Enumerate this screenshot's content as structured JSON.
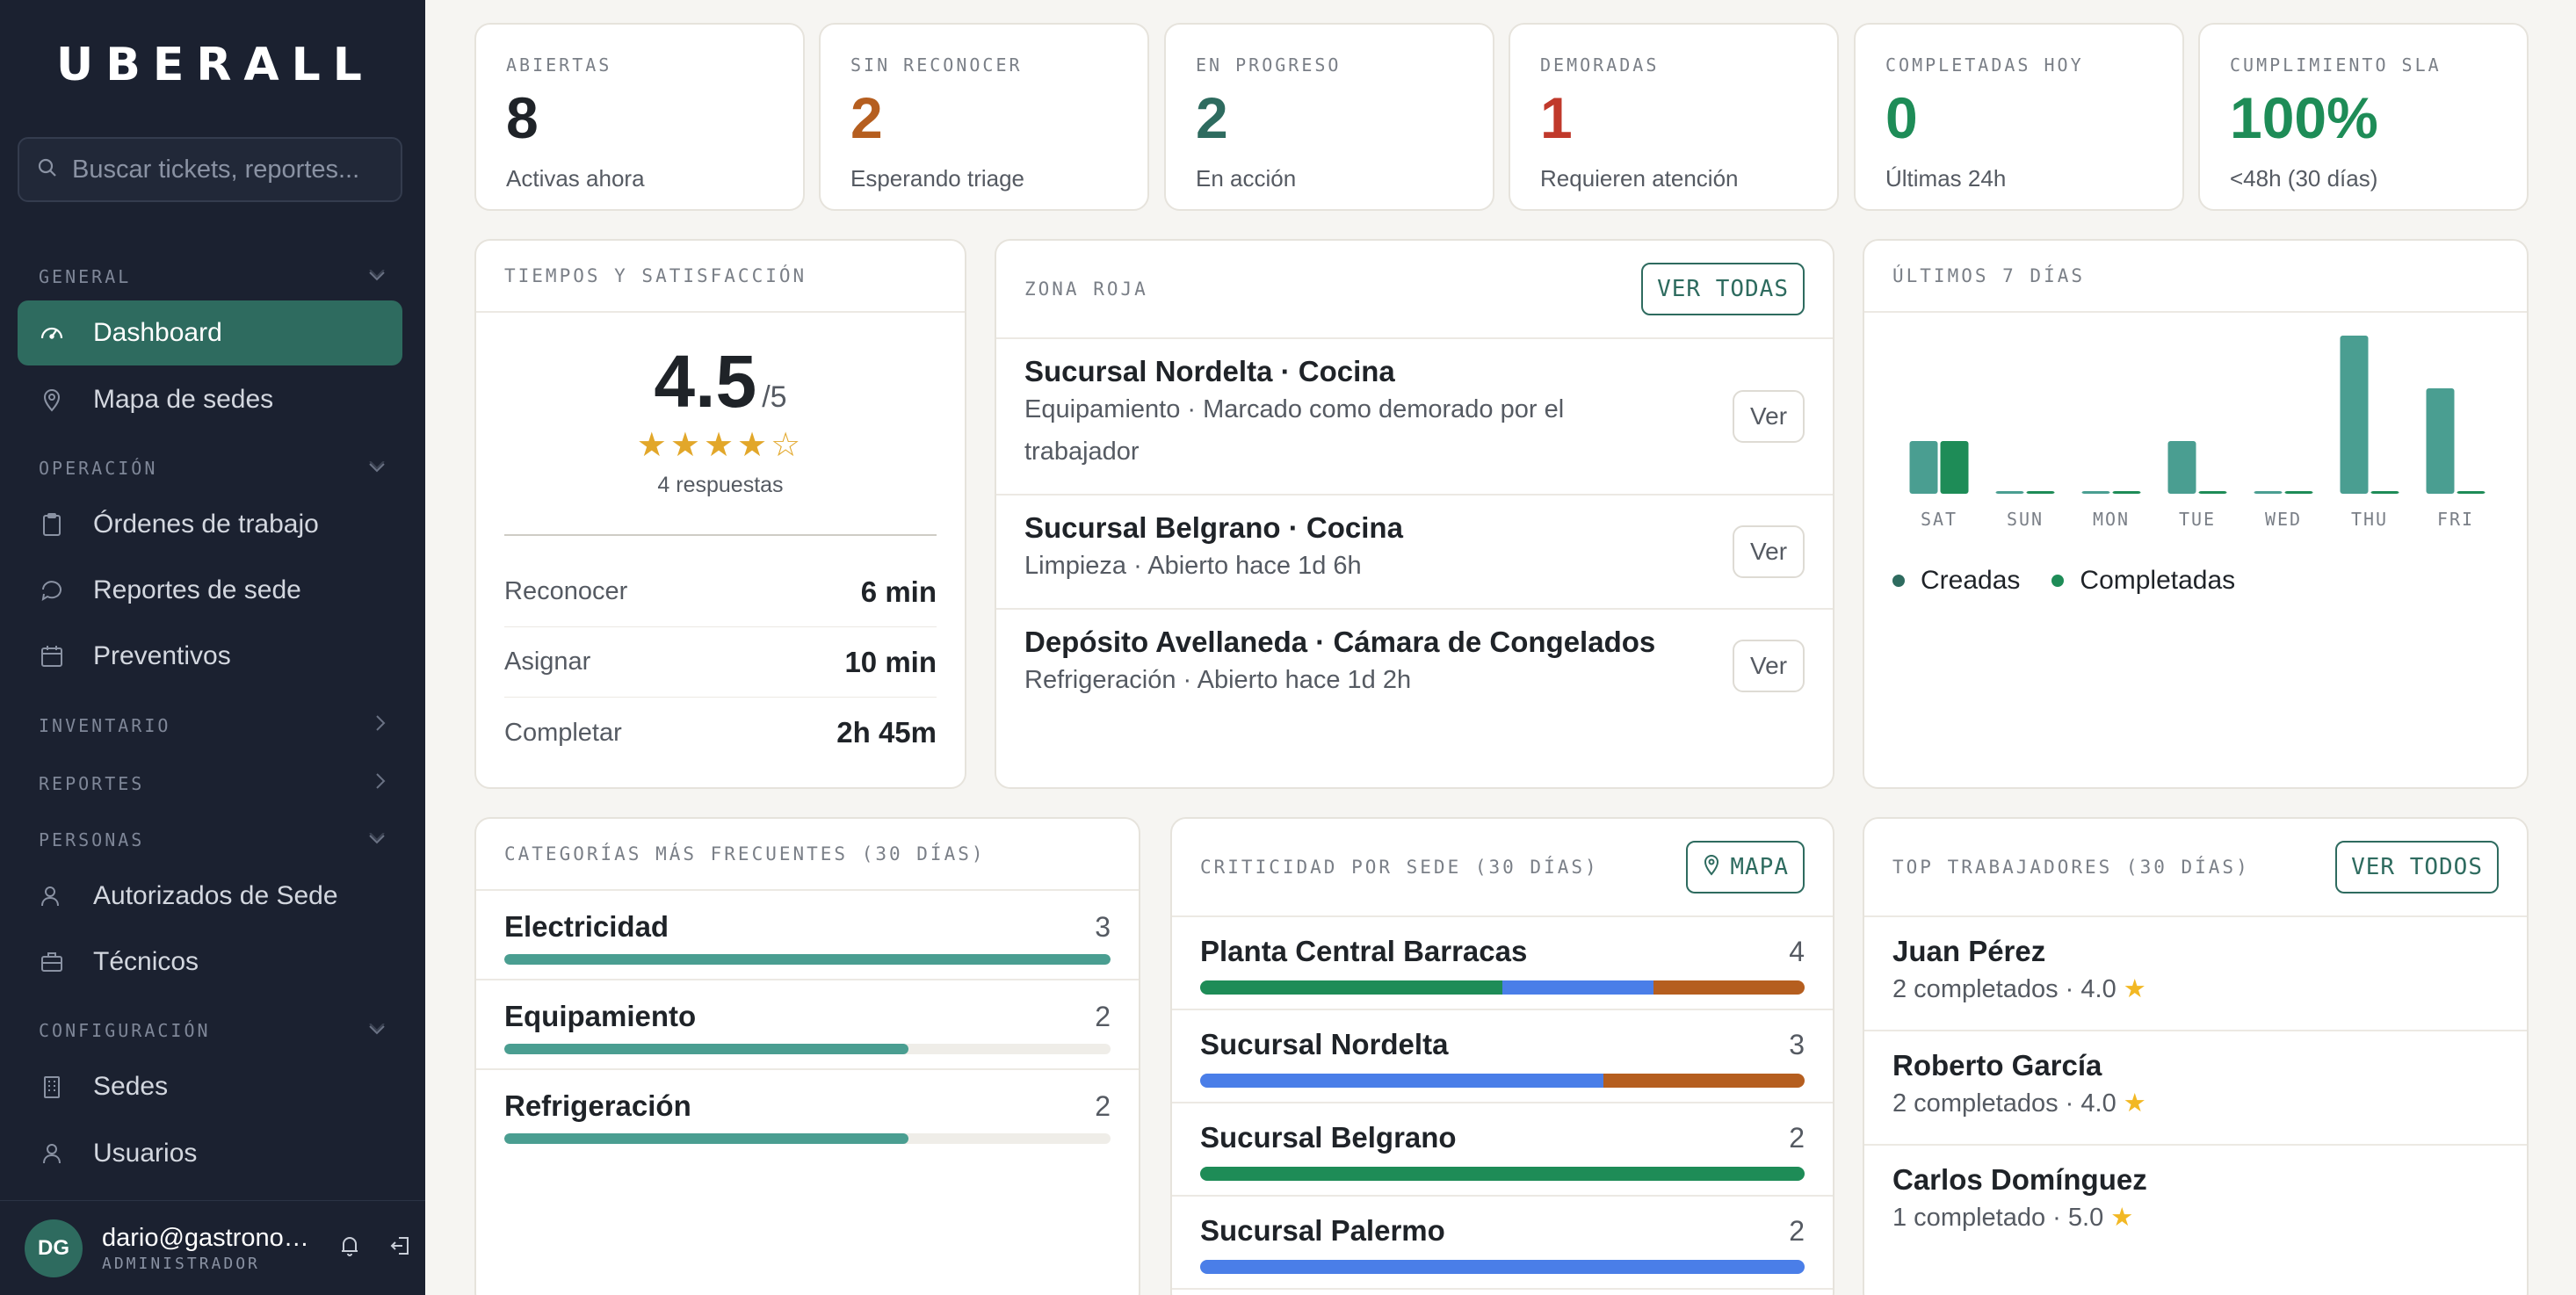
{
  "sidebar": {
    "logo": "UBERALL",
    "search_placeholder": "Buscar tickets, reportes...",
    "sections": {
      "general": "GENERAL",
      "operacion": "OPERACIÓN",
      "inventario": "INVENTARIO",
      "reportes": "REPORTES",
      "personas": "PERSONAS",
      "configuracion": "CONFIGURACIÓN"
    },
    "items": {
      "dashboard": "Dashboard",
      "mapa": "Mapa de sedes",
      "ordenes": "Órdenes de trabajo",
      "reportes_sede": "Reportes de sede",
      "preventivos": "Preventivos",
      "autorizados": "Autorizados de Sede",
      "tecnicos": "Técnicos",
      "sedes": "Sedes",
      "usuarios": "Usuarios"
    },
    "user": {
      "initials": "DG",
      "email": "dario@gastronomia.com",
      "role": "ADMINISTRADOR"
    }
  },
  "kpis": [
    {
      "label": "ABIERTAS",
      "value": "8",
      "sub": "Activas ahora",
      "color": "#1f2328"
    },
    {
      "label": "SIN RECONOCER",
      "value": "2",
      "sub": "Esperando triage",
      "color": "#b55e1f"
    },
    {
      "label": "EN PROGRESO",
      "value": "2",
      "sub": "En acción",
      "color": "#2e6b5f"
    },
    {
      "label": "DEMORADAS",
      "value": "1",
      "sub": "Requieren atención",
      "color": "#c0392b"
    },
    {
      "label": "COMPLETADAS HOY",
      "value": "0",
      "sub": "Últimas 24h",
      "color": "#1e8c57"
    },
    {
      "label": "CUMPLIMIENTO SLA",
      "value": "100%",
      "sub": "<48h (30 días)",
      "color": "#1e8c57"
    }
  ],
  "tiempos": {
    "title": "TIEMPOS Y SATISFACCIÓN",
    "score": "4.5",
    "score_max": "/5",
    "stars": 4,
    "responses": "4 respuestas",
    "rows": [
      {
        "label": "Reconocer",
        "value": "6 min"
      },
      {
        "label": "Asignar",
        "value": "10 min"
      },
      {
        "label": "Completar",
        "value": "2h 45m"
      }
    ]
  },
  "zona_roja": {
    "title": "ZONA ROJA",
    "button": "VER TODAS",
    "ver_label": "Ver",
    "items": [
      {
        "title": "Sucursal Nordelta · Cocina",
        "sub1": "Equipamiento · Marcado como demorado por el",
        "sub2": "trabajador"
      },
      {
        "title": "Sucursal Belgrano · Cocina",
        "sub1": "Limpieza · Abierto hace 1d 6h",
        "sub2": ""
      },
      {
        "title": "Depósito Avellaneda · Cámara de Congelados",
        "sub1": "Refrigeración · Abierto hace 1d 2h",
        "sub2": ""
      }
    ]
  },
  "ultimos": {
    "title": "ÚLTIMOS 7 DÍAS",
    "legend": [
      "Creadas",
      "Completadas"
    ]
  },
  "chart_data": {
    "type": "bar",
    "categories": [
      "SAT",
      "SUN",
      "MON",
      "TUE",
      "WED",
      "THU",
      "FRI"
    ],
    "series": [
      {
        "name": "Creadas",
        "values": [
          1,
          0,
          0,
          1,
          0,
          3,
          2
        ],
        "color": "#4a9e91"
      },
      {
        "name": "Completadas",
        "values": [
          1,
          0,
          0,
          0,
          0,
          0,
          0
        ],
        "color": "#1e8c57"
      }
    ],
    "title": "ÚLTIMOS 7 DÍAS",
    "legend": "bottom-left",
    "ylim": [
      0,
      3
    ],
    "grid": false
  },
  "categorias": {
    "title": "CATEGORÍAS MÁS FRECUENTES (30 DÍAS)",
    "max": 3,
    "items": [
      {
        "name": "Electricidad",
        "count": "3",
        "value": 3
      },
      {
        "name": "Equipamiento",
        "count": "2",
        "value": 2
      },
      {
        "name": "Refrigeración",
        "count": "2",
        "value": 2
      }
    ]
  },
  "criticidad": {
    "title": "CRITICIDAD POR SEDE (30 DÍAS)",
    "button": "MAPA",
    "colors": {
      "baja": "#1e8c57",
      "media": "#4a7ee8",
      "alta": "#b55e1f"
    },
    "items": [
      {
        "name": "Planta Central Barracas",
        "count": "4",
        "segments": [
          2,
          1,
          1
        ]
      },
      {
        "name": "Sucursal Nordelta",
        "count": "3",
        "segments": [
          0,
          2,
          1
        ]
      },
      {
        "name": "Sucursal Belgrano",
        "count": "2",
        "segments": [
          2,
          0,
          0
        ]
      },
      {
        "name": "Sucursal Palermo",
        "count": "2",
        "segments": [
          0,
          2,
          0
        ]
      }
    ]
  },
  "top": {
    "title": "TOP TRABAJADORES (30 DÍAS)",
    "button": "VER TODOS",
    "items": [
      {
        "name": "Juan Pérez",
        "sub": "2 completados · 4.0"
      },
      {
        "name": "Roberto García",
        "sub": "2 completados · 4.0"
      },
      {
        "name": "Carlos Domínguez",
        "sub": "1 completado · 5.0"
      }
    ]
  }
}
